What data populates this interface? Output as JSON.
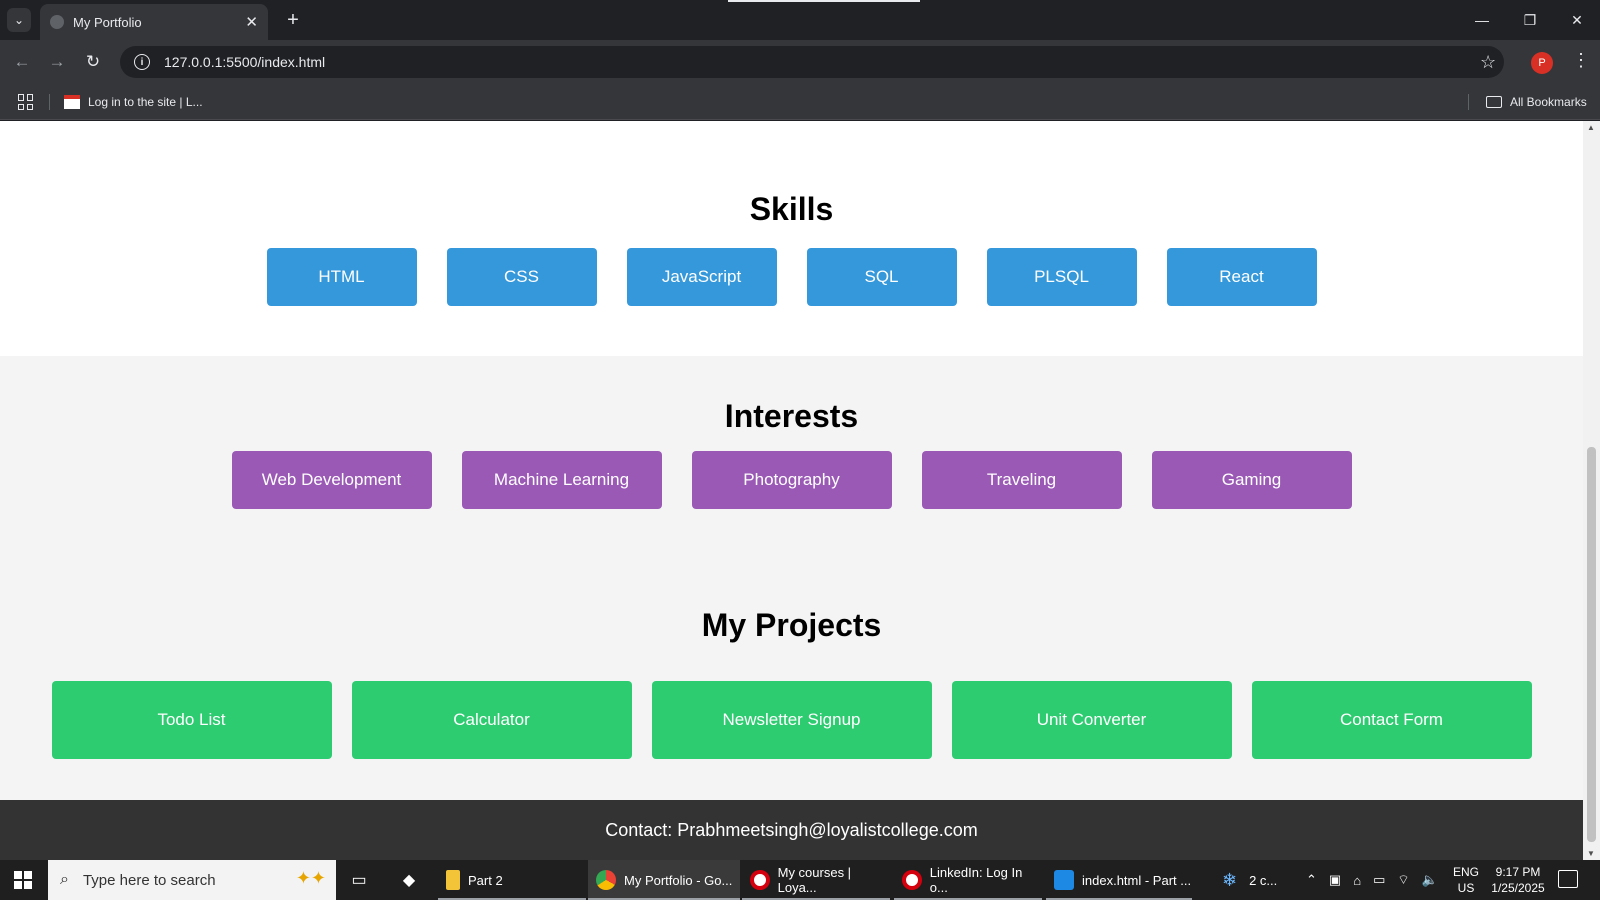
{
  "browser": {
    "tab_title": "My Portfolio",
    "tab_close": "✕",
    "new_tab": "+",
    "url": "127.0.0.1:5500/index.html",
    "profile_initial": "P",
    "bookmarks": {
      "item_label": "Log in to the site | L...",
      "all_label": "All Bookmarks"
    },
    "window_controls": {
      "minimize": "—",
      "restore": "❐",
      "close": "✕"
    }
  },
  "page": {
    "skills": {
      "title": "Skills",
      "items": [
        "HTML",
        "CSS",
        "JavaScript",
        "SQL",
        "PLSQL",
        "React"
      ]
    },
    "interests": {
      "title": "Interests",
      "items": [
        "Web Development",
        "Machine Learning",
        "Photography",
        "Traveling",
        "Gaming"
      ]
    },
    "projects": {
      "title": "My Projects",
      "items": [
        "Todo List",
        "Calculator",
        "Newsletter Signup",
        "Unit Converter",
        "Contact Form"
      ]
    },
    "footer": {
      "contact": "Contact: Prabhmeetsingh@loyalistcollege.com"
    }
  },
  "colors": {
    "skills_chip": "#3498db",
    "interests_chip": "#9b59b6",
    "projects_chip": "#2ecc71",
    "footer_bg": "#333333"
  },
  "taskbar": {
    "search_placeholder": "Type here to search",
    "apps": [
      {
        "label": "Part 2",
        "icon": "file-explorer-icon"
      },
      {
        "label": "My Portfolio - Go...",
        "icon": "chrome-icon"
      },
      {
        "label": "My courses | Loya...",
        "icon": "opera-icon"
      },
      {
        "label": "LinkedIn: Log In o...",
        "icon": "opera-icon"
      },
      {
        "label": "index.html - Part ...",
        "icon": "vscode-icon"
      }
    ],
    "weather": "2 c...",
    "lang_line1": "ENG",
    "lang_line2": "US",
    "time": "9:17 PM",
    "date": "1/25/2025"
  }
}
